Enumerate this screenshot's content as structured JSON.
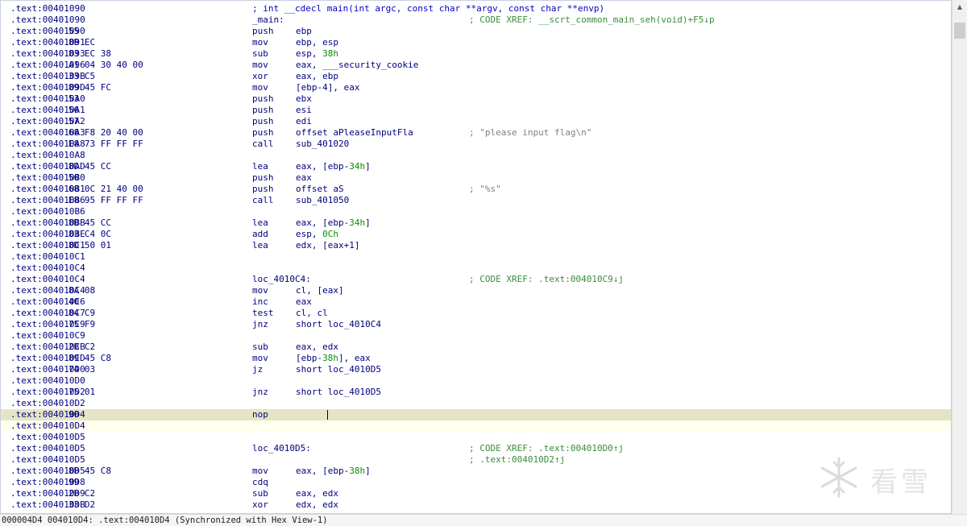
{
  "disasm": {
    "lines": [
      {
        "addr": ".text:00401090",
        "bytes": "",
        "decl": "; int __cdecl main(int argc, const char **argv, const char **envp)",
        "label": "",
        "mn": "",
        "op": [],
        "cmt": ""
      },
      {
        "addr": ".text:00401090",
        "bytes": "",
        "decl": "",
        "label": "_main:",
        "mn": "",
        "op": [],
        "cmt": "; CODE XREF: __scrt_common_main_seh(void)+F5↓p"
      },
      {
        "addr": ".text:00401090",
        "bytes": "55",
        "label": "",
        "mn": "push",
        "op": [
          {
            "t": "ebp"
          }
        ],
        "cmt": ""
      },
      {
        "addr": ".text:00401091",
        "bytes": "8B EC",
        "label": "",
        "mn": "mov",
        "op": [
          {
            "t": "ebp, esp"
          }
        ],
        "cmt": ""
      },
      {
        "addr": ".text:00401093",
        "bytes": "83 EC 38",
        "label": "",
        "mn": "sub",
        "op": [
          {
            "t": "esp, "
          },
          {
            "t": "38h",
            "c": "num"
          }
        ],
        "cmt": ""
      },
      {
        "addr": ".text:00401096",
        "bytes": "A1 04 30 40 00",
        "label": "",
        "mn": "mov",
        "op": [
          {
            "t": "eax, ___security_cookie"
          }
        ],
        "cmt": ""
      },
      {
        "addr": ".text:0040109B",
        "bytes": "33 C5",
        "label": "",
        "mn": "xor",
        "op": [
          {
            "t": "eax, ebp"
          }
        ],
        "cmt": ""
      },
      {
        "addr": ".text:0040109D",
        "bytes": "89 45 FC",
        "label": "",
        "mn": "mov",
        "op": [
          {
            "t": "[ebp-4], eax"
          }
        ],
        "cmt": ""
      },
      {
        "addr": ".text:004010A0",
        "bytes": "53",
        "label": "",
        "mn": "push",
        "op": [
          {
            "t": "ebx"
          }
        ],
        "cmt": ""
      },
      {
        "addr": ".text:004010A1",
        "bytes": "56",
        "label": "",
        "mn": "push",
        "op": [
          {
            "t": "esi"
          }
        ],
        "cmt": ""
      },
      {
        "addr": ".text:004010A2",
        "bytes": "57",
        "label": "",
        "mn": "push",
        "op": [
          {
            "t": "edi"
          }
        ],
        "cmt": ""
      },
      {
        "addr": ".text:004010A3",
        "bytes": "68 F8 20 40 00",
        "label": "",
        "mn": "push",
        "op": [
          {
            "t": "offset aPleaseInputFla"
          }
        ],
        "str": "; \"please input flag\\n\""
      },
      {
        "addr": ".text:004010A8",
        "bytes": "E8 73 FF FF FF",
        "label": "",
        "mn": "call",
        "op": [
          {
            "t": "sub_401020"
          }
        ],
        "cmt": ""
      },
      {
        "addr": ".text:004010A8",
        "bytes": "",
        "label": "",
        "mn": "",
        "op": [],
        "cmt": ""
      },
      {
        "addr": ".text:004010AD",
        "bytes": "8D 45 CC",
        "label": "",
        "mn": "lea",
        "op": [
          {
            "t": "eax, [ebp-"
          },
          {
            "t": "34h",
            "c": "num"
          },
          {
            "t": "]"
          }
        ],
        "cmt": ""
      },
      {
        "addr": ".text:004010B0",
        "bytes": "50",
        "label": "",
        "mn": "push",
        "op": [
          {
            "t": "eax"
          }
        ],
        "cmt": ""
      },
      {
        "addr": ".text:004010B1",
        "bytes": "68 0C 21 40 00",
        "label": "",
        "mn": "push",
        "op": [
          {
            "t": "offset aS"
          }
        ],
        "str": "; \"%s\""
      },
      {
        "addr": ".text:004010B6",
        "bytes": "E8 95 FF FF FF",
        "label": "",
        "mn": "call",
        "op": [
          {
            "t": "sub_401050"
          }
        ],
        "cmt": ""
      },
      {
        "addr": ".text:004010B6",
        "bytes": "",
        "label": "",
        "mn": "",
        "op": [],
        "cmt": ""
      },
      {
        "addr": ".text:004010BB",
        "bytes": "8D 45 CC",
        "label": "",
        "mn": "lea",
        "op": [
          {
            "t": "eax, [ebp-"
          },
          {
            "t": "34h",
            "c": "num"
          },
          {
            "t": "]"
          }
        ],
        "cmt": ""
      },
      {
        "addr": ".text:004010BE",
        "bytes": "83 C4 0C",
        "label": "",
        "mn": "add",
        "op": [
          {
            "t": "esp, "
          },
          {
            "t": "0Ch",
            "c": "num"
          }
        ],
        "cmt": ""
      },
      {
        "addr": ".text:004010C1",
        "bytes": "8D 50 01",
        "label": "",
        "mn": "lea",
        "op": [
          {
            "t": "edx, [eax+1]"
          }
        ],
        "cmt": ""
      },
      {
        "addr": ".text:004010C1",
        "bytes": "",
        "label": "",
        "mn": "",
        "op": [],
        "cmt": ""
      },
      {
        "addr": ".text:004010C4",
        "bytes": "",
        "label": "",
        "mn": "",
        "op": [],
        "cmt": ""
      },
      {
        "addr": ".text:004010C4",
        "bytes": "",
        "label": "loc_4010C4:",
        "mn": "",
        "op": [],
        "cmt": "; CODE XREF: .text:004010C9↓j"
      },
      {
        "addr": ".text:004010C4",
        "bytes": "8A 08",
        "label": "",
        "mn": "mov",
        "op": [
          {
            "t": "cl, [eax]"
          }
        ],
        "cmt": ""
      },
      {
        "addr": ".text:004010C6",
        "bytes": "40",
        "label": "",
        "mn": "inc",
        "op": [
          {
            "t": "eax"
          }
        ],
        "cmt": ""
      },
      {
        "addr": ".text:004010C7",
        "bytes": "84 C9",
        "label": "",
        "mn": "test",
        "op": [
          {
            "t": "cl, cl"
          }
        ],
        "cmt": ""
      },
      {
        "addr": ".text:004010C9",
        "bytes": "75 F9",
        "label": "",
        "mn": "jnz",
        "op": [
          {
            "t": "short loc_4010C4"
          }
        ],
        "cmt": ""
      },
      {
        "addr": ".text:004010C9",
        "bytes": "",
        "label": "",
        "mn": "",
        "op": [],
        "cmt": ""
      },
      {
        "addr": ".text:004010CB",
        "bytes": "2B C2",
        "label": "",
        "mn": "sub",
        "op": [
          {
            "t": "eax, edx"
          }
        ],
        "cmt": ""
      },
      {
        "addr": ".text:004010CD",
        "bytes": "89 45 C8",
        "label": "",
        "mn": "mov",
        "op": [
          {
            "t": "[ebp-"
          },
          {
            "t": "38h",
            "c": "num"
          },
          {
            "t": "], eax"
          }
        ],
        "cmt": ""
      },
      {
        "addr": ".text:004010D0",
        "bytes": "74 03",
        "label": "",
        "mn": "jz",
        "op": [
          {
            "t": "short loc_4010D5"
          }
        ],
        "cmt": ""
      },
      {
        "addr": ".text:004010D0",
        "bytes": "",
        "label": "",
        "mn": "",
        "op": [],
        "cmt": ""
      },
      {
        "addr": ".text:004010D2",
        "bytes": "75 01",
        "label": "",
        "mn": "jnz",
        "op": [
          {
            "t": "short loc_4010D5"
          }
        ],
        "cmt": ""
      },
      {
        "addr": ".text:004010D2",
        "bytes": "",
        "label": "",
        "mn": "",
        "op": [],
        "cmt": ""
      },
      {
        "addr": ".text:004010D4",
        "bytes": "90",
        "label": "",
        "mn": "nop",
        "op": [],
        "cmt": "",
        "hl": "selected"
      },
      {
        "addr": ".text:004010D4",
        "bytes": "",
        "label": "",
        "mn": "",
        "op": [],
        "cmt": "",
        "hl": "current"
      },
      {
        "addr": ".text:004010D5",
        "bytes": "",
        "label": "",
        "mn": "",
        "op": [],
        "cmt": ""
      },
      {
        "addr": ".text:004010D5",
        "bytes": "",
        "label": "loc_4010D5:",
        "mn": "",
        "op": [],
        "cmt": "; CODE XREF: .text:004010D0↑j"
      },
      {
        "addr": ".text:004010D5",
        "bytes": "",
        "label": "",
        "mn": "",
        "op": [],
        "cmt": "; .text:004010D2↑j"
      },
      {
        "addr": ".text:004010D5",
        "bytes": "8B 45 C8",
        "label": "",
        "mn": "mov",
        "op": [
          {
            "t": "eax, [ebp-"
          },
          {
            "t": "38h",
            "c": "num"
          },
          {
            "t": "]"
          }
        ],
        "cmt": ""
      },
      {
        "addr": ".text:004010D8",
        "bytes": "99",
        "label": "",
        "mn": "cdq",
        "op": [],
        "cmt": ""
      },
      {
        "addr": ".text:004010D9",
        "bytes": "2B C2",
        "label": "",
        "mn": "sub",
        "op": [
          {
            "t": "eax, edx"
          }
        ],
        "cmt": ""
      },
      {
        "addr": ".text:004010DB",
        "bytes": "33 D2",
        "label": "",
        "mn": "xor",
        "op": [
          {
            "t": "edx, edx"
          }
        ],
        "cmt": ""
      }
    ]
  },
  "status_bar": {
    "text": "000004D4 004010D4: .text:004010D4 (Synchronized with Hex View-1)"
  },
  "watermark": {
    "text": "看雪",
    "icon": "snowflake-icon"
  },
  "colors": {
    "address": "#000080",
    "comment": "#3a8c3a",
    "number": "#0a8c0a",
    "string_comment": "#808080",
    "selected_line": "#e5e5c6",
    "current_line": "#ffffee"
  }
}
